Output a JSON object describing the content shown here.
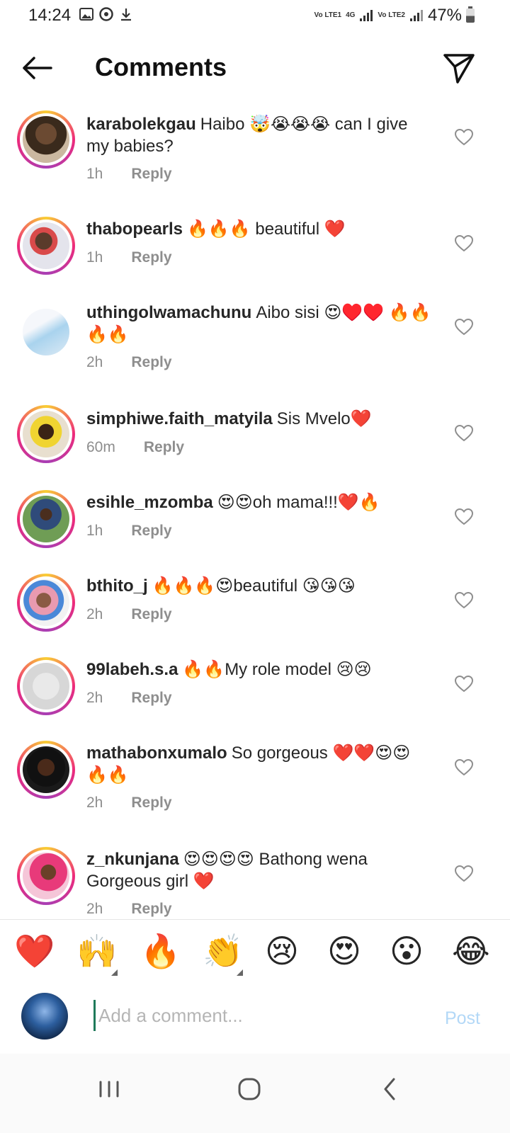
{
  "status_bar": {
    "time": "14:24",
    "network_1": "Vo LTE1",
    "network_2": "Vo LTE2",
    "network_type": "4G",
    "battery": "47%"
  },
  "header": {
    "title": "Comments",
    "back_icon": "arrow-left-icon",
    "send_icon": "paper-plane-icon"
  },
  "comments": [
    {
      "username": "karabolekgau",
      "text": "Haibo 🤯😭😭😭 can I give my babies?",
      "time": "1h",
      "reply": "Reply"
    },
    {
      "username": "thabopearls",
      "text": "🔥🔥🔥 beautiful ❤️",
      "time": "1h",
      "reply": "Reply"
    },
    {
      "username": "uthingolwamachunu",
      "text": "Aibo sisi 😍♥️♥️ 🔥🔥🔥🔥",
      "time": "2h",
      "reply": "Reply"
    },
    {
      "username": "simphiwe.faith_matyila",
      "text": "Sis Mvelo❤️",
      "time": "60m",
      "reply": "Reply"
    },
    {
      "username": "esihle_mzomba",
      "text": "😍😍oh mama!!!❤️🔥",
      "time": "1h",
      "reply": "Reply"
    },
    {
      "username": "bthito_j",
      "text": "🔥🔥🔥😍beautiful 😘😘😘",
      "time": "2h",
      "reply": "Reply"
    },
    {
      "username": "99labeh.s.a",
      "text": "🔥🔥My role model 😢😢",
      "time": "2h",
      "reply": "Reply"
    },
    {
      "username": "mathabonxumalo",
      "text": "So gorgeous ❤️❤️😍😍 🔥🔥",
      "time": "2h",
      "reply": "Reply"
    },
    {
      "username": "z_nkunjana",
      "text": "😍😍😍😍 Bathong wena Gorgeous girl ❤️",
      "time": "2h",
      "reply": "Reply"
    }
  ],
  "emoji_bar": [
    "❤️",
    "🙌",
    "🔥",
    "👏",
    "😢",
    "😍",
    "😮",
    "😂"
  ],
  "composer": {
    "placeholder": "Add a comment...",
    "post_label": "Post"
  },
  "colors": {
    "accent_blue_disabled": "#b3d8f7",
    "story_ring_start": "#f9ce34",
    "story_ring_mid": "#ee2a7b",
    "story_ring_end": "#a83eb4",
    "like_heart": "#262626",
    "muted_text": "#8e8e8e"
  }
}
